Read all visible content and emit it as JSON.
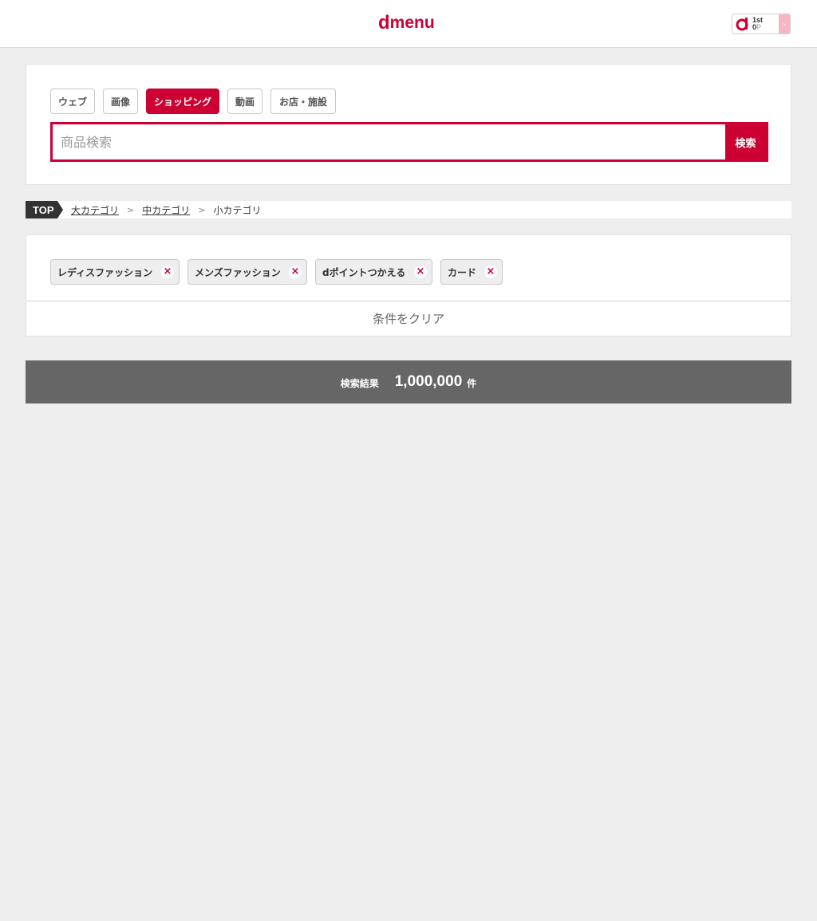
{
  "header": {
    "logo_d": "d",
    "logo_menu": "menu",
    "points": {
      "rank": "1st",
      "value": "0",
      "unit": "P"
    }
  },
  "search": {
    "tabs": [
      {
        "label": "ウェブ",
        "active": false
      },
      {
        "label": "画像",
        "active": false
      },
      {
        "label": "ショッピング",
        "active": true
      },
      {
        "label": "動画",
        "active": false
      },
      {
        "label": "お店・施設",
        "active": false
      }
    ],
    "placeholder": "商品検索",
    "button_label": "検索"
  },
  "breadcrumb": {
    "top": "TOP",
    "items": [
      {
        "label": "大カテゴリ"
      },
      {
        "label": "中カテゴリ"
      },
      {
        "label": "小カテゴリ"
      }
    ],
    "separator": ">"
  },
  "filters": {
    "chips": [
      {
        "label": "レディスファッション",
        "remove": "×"
      },
      {
        "label": "メンズファッション",
        "remove": "×"
      },
      {
        "label": "dポイントつかえる",
        "remove": "×"
      },
      {
        "label": "カード",
        "remove": "×"
      }
    ],
    "clear_label": "条件をクリア"
  },
  "results": {
    "label": "検索結果",
    "count": "1,000,000",
    "unit": "件"
  },
  "colors": {
    "brand": "#cc0033",
    "background": "#eeeeee",
    "results_bar": "#666666"
  }
}
